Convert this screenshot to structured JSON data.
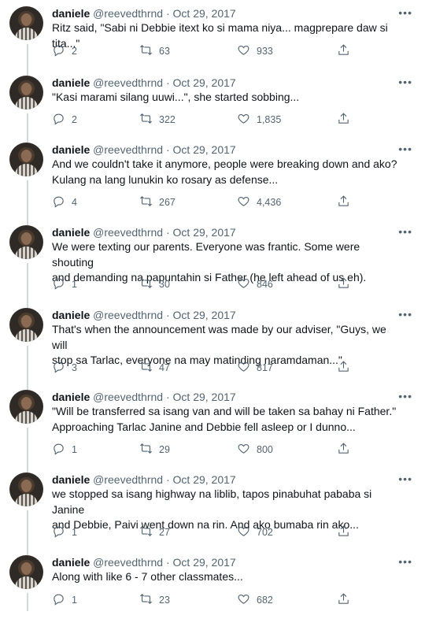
{
  "author": {
    "name": "daniele",
    "handle": "@reevedthrnd",
    "date": "Oct 29, 2017",
    "separator": "·"
  },
  "more_label": "•••",
  "tweets": [
    {
      "lines": [
        "Ritz said, \"Sabi ni Debbie itext ko si mama niya... magprepare daw si tita...\""
      ],
      "replies": "2",
      "retweets": "63",
      "likes": "933"
    },
    {
      "lines": [
        "\"Kasi marami silang uuwi...\", she started sobbing..."
      ],
      "replies": "2",
      "retweets": "322",
      "likes": "1,835"
    },
    {
      "lines": [
        "And we couldn't take it anymore, people were breaking down and ako?",
        "Kulang na lang lunukin ko rosary as defense..."
      ],
      "replies": "4",
      "retweets": "267",
      "likes": "4,436"
    },
    {
      "lines": [
        "We were texting our parents. Everyone was frantic. Some were shouting",
        "and demanding na papuntahin si Father (he left ahead of us eh)."
      ],
      "replies": "1",
      "retweets": "30",
      "likes": "846"
    },
    {
      "lines": [
        "That's when the announcement was made by our adviser, \"Guys, we will",
        "stop sa Tarlac, everyone na may matinding naramdaman...\""
      ],
      "replies": "3",
      "retweets": "47",
      "likes": "817"
    },
    {
      "lines": [
        "\"Will be transferred sa isang van and will be taken sa bahay ni Father.\"",
        "Approaching Tarlac Janine and Debbie fell asleep or I dunno..."
      ],
      "replies": "1",
      "retweets": "29",
      "likes": "800"
    },
    {
      "lines": [
        "we stopped sa isang highway na liblib, tapos pinabuhat pababa si Janine",
        "and Debbie, Paivi went down na rin. And ako bumaba rin ako..."
      ],
      "replies": "1",
      "retweets": "27",
      "likes": "702"
    },
    {
      "lines": [
        "Along with like 6 - 7 other classmates..."
      ],
      "replies": "1",
      "retweets": "23",
      "likes": "682"
    }
  ]
}
